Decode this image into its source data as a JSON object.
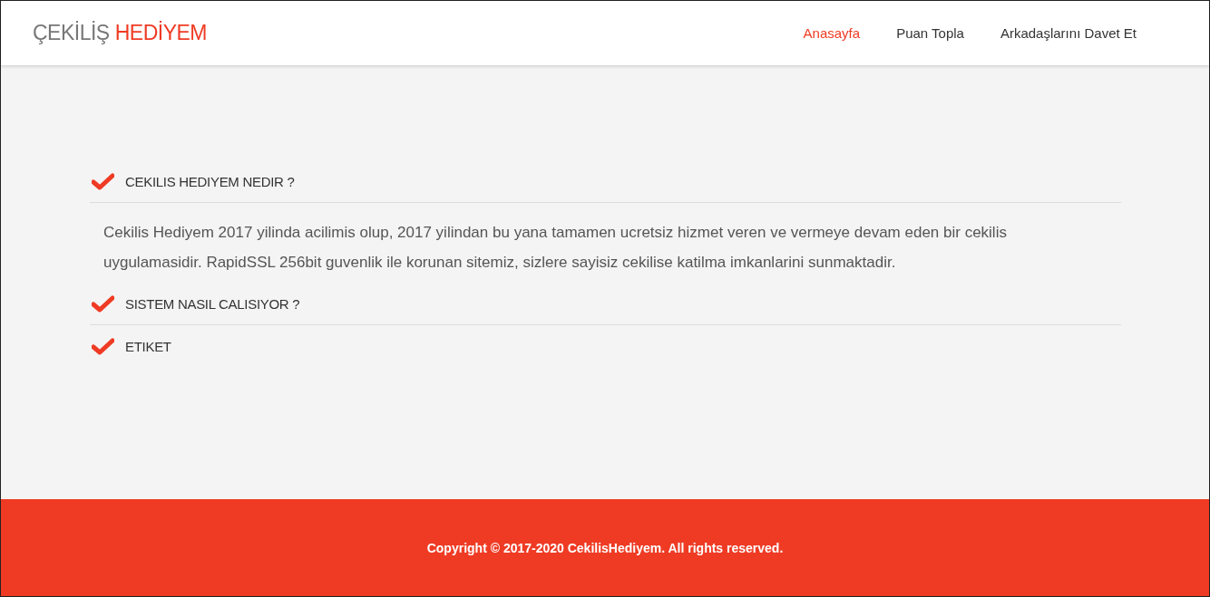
{
  "logo": {
    "first": "ÇEKİLİŞ",
    "second": "HEDİYEM"
  },
  "nav": [
    {
      "label": "Anasayfa",
      "selected": true
    },
    {
      "label": "Puan Topla",
      "selected": false
    },
    {
      "label": "Arkadaşlarını Davet Et",
      "selected": false
    }
  ],
  "faq": [
    {
      "title": "CEKILIS HEDIYEM NEDIR ?",
      "body": "Cekilis Hediyem 2017 yilinda acilimis olup, 2017 yilindan bu yana tamamen ucretsiz hizmet veren ve vermeye devam eden bir cekilis uygulamasidir. RapidSSL 256bit guvenlik ile korunan sitemiz, sizlere sayisiz cekilise katilma imkanlarini sunmaktadir."
    },
    {
      "title": "SISTEM NASIL CALISIYOR ?"
    },
    {
      "title": "ETIKET"
    }
  ],
  "footer": {
    "copyright": "Copyright © 2017-2020 CekilisHediyem. All rights reserved."
  }
}
